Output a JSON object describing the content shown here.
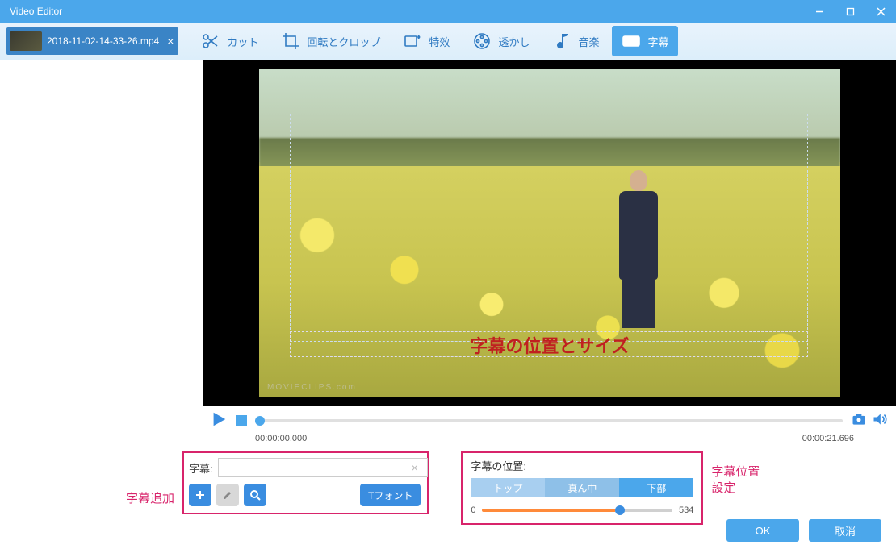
{
  "window": {
    "title": "Video Editor"
  },
  "file_tab": {
    "name": "2018-11-02-14-33-26.mp4"
  },
  "toolbar": {
    "cut": "カット",
    "rotate_crop": "回転とクロップ",
    "effects": "特效",
    "watermark": "透かし",
    "music": "音楽",
    "subtitle": "字幕"
  },
  "preview": {
    "subtitle_overlay": "字幕の位置とサイズ",
    "watermark": "MOVIECLIPS.com"
  },
  "playback": {
    "current_time": "00:00:00.000",
    "duration": "00:00:21.696"
  },
  "subtitle_panel": {
    "annotation": "字幕追加",
    "label": "字幕:",
    "input_value": "",
    "font_button": "Tフォント"
  },
  "position_panel": {
    "annotation": "字幕位置\n設定",
    "title": "字幕の位置:",
    "options": {
      "top": "トップ",
      "middle": "真ん中",
      "bottom": "下部"
    },
    "slider": {
      "min": "0",
      "value": "534"
    }
  },
  "footer": {
    "ok": "OK",
    "cancel": "取消"
  }
}
